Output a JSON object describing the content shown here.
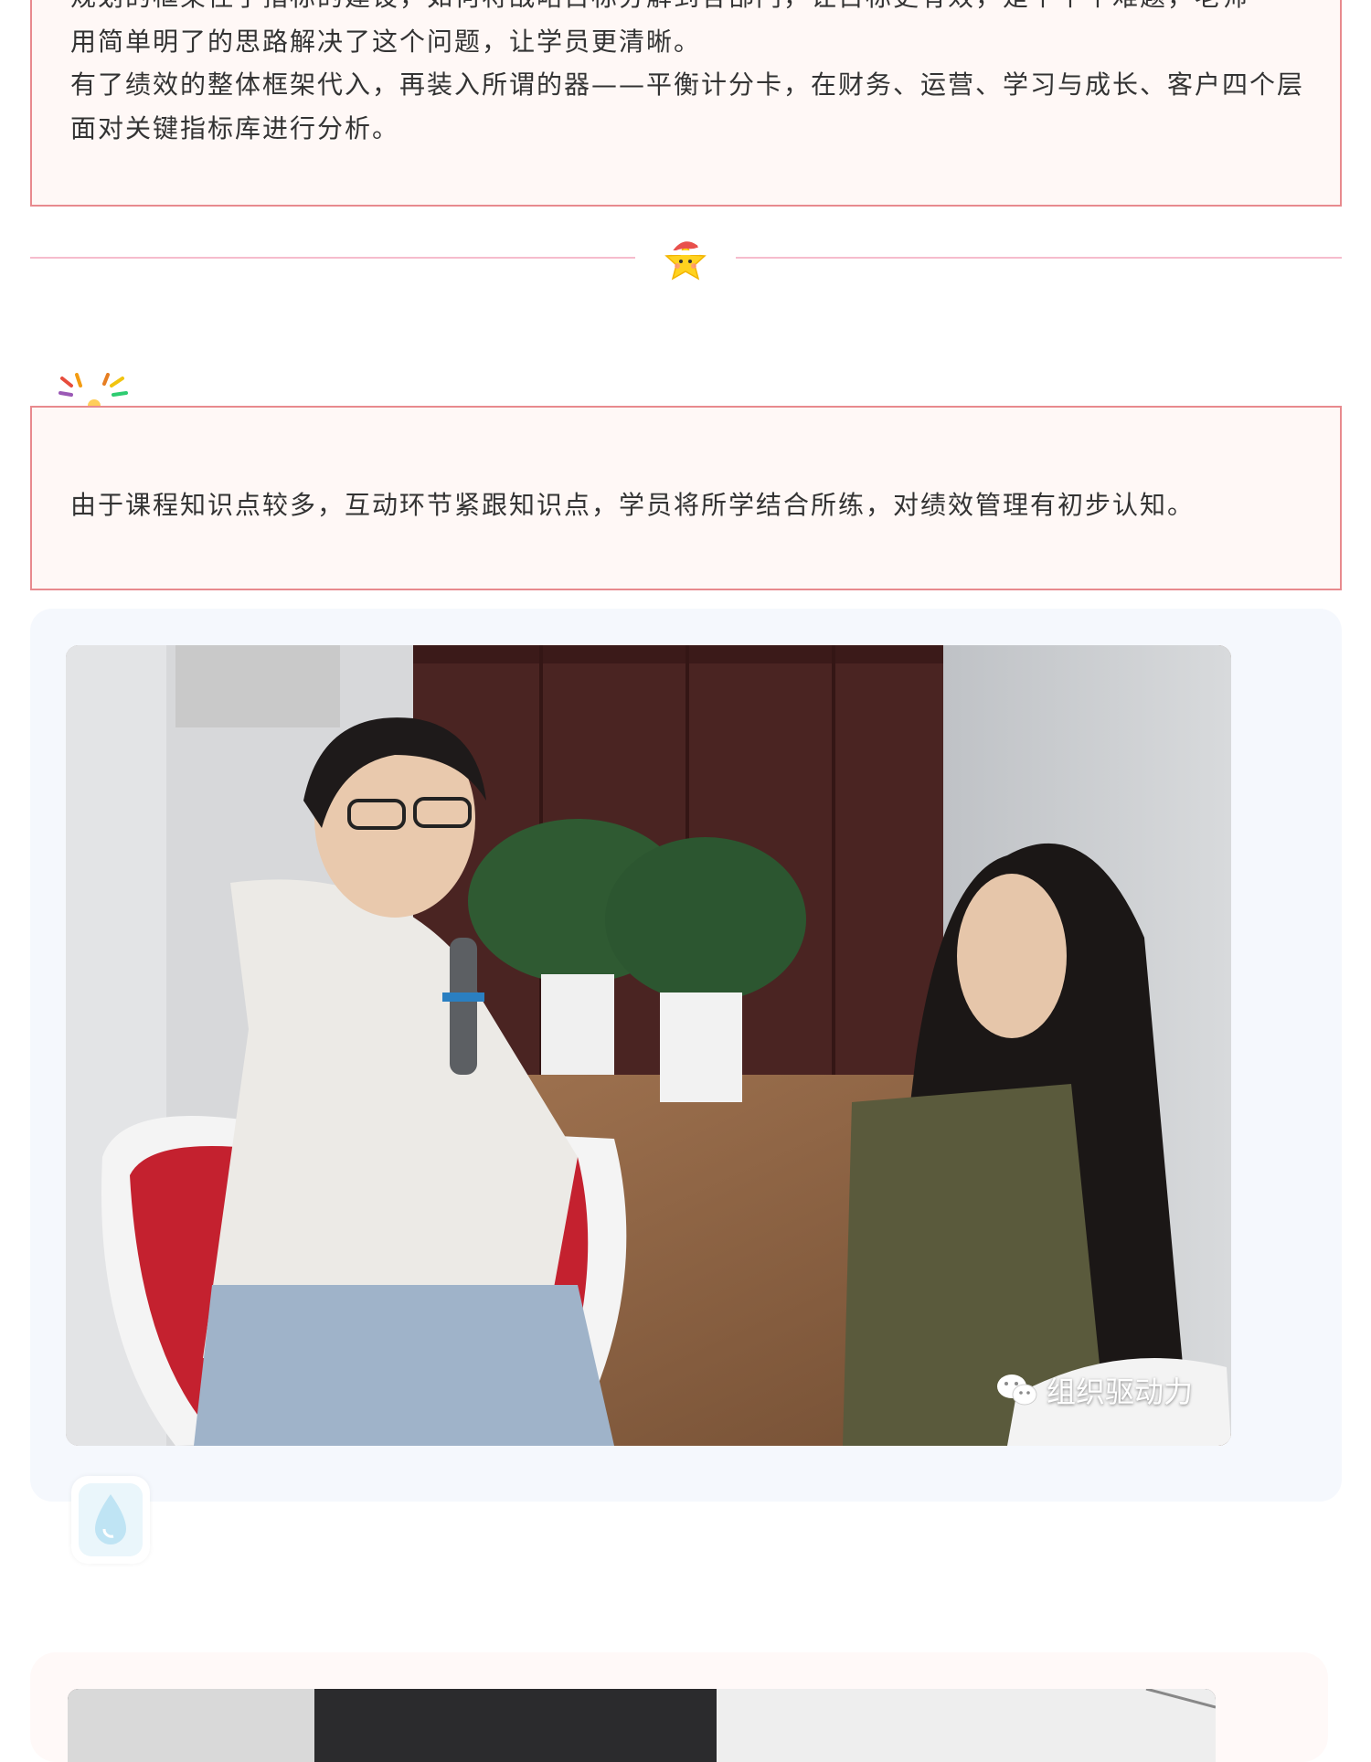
{
  "article": {
    "paragraph_1_cut": "规划的框架住了指标的建设，如何将战略目标分解到各部门，让目标更有效，是个个个难题，老师",
    "paragraph_1": "用简单明了的思路解决了这个问题，让学员更清晰。",
    "paragraph_2": "有了绩效的整体框架代入，再装入所谓的器——平衡计分卡，在财务、运营、学习与成长、客户四个层面对关键指标库进行分析。",
    "paragraph_3": "由于课程知识点较多，互动环节紧跟知识点，学员将所学结合所练，对绩效管理有初步认知。"
  },
  "photo": {
    "watermark_text": "组织驱动力",
    "watermark_icon": "wechat-icon"
  },
  "decorations": {
    "divider_icon": "santa-star-icon",
    "section_icon": "firework-icon",
    "drop_icon": "water-drop-icon"
  },
  "colors": {
    "card_border": "#e88a8e",
    "card_bg": "#fff8f6",
    "divider": "#f6bccd",
    "photo_card_bg": "#f5f8fd"
  }
}
